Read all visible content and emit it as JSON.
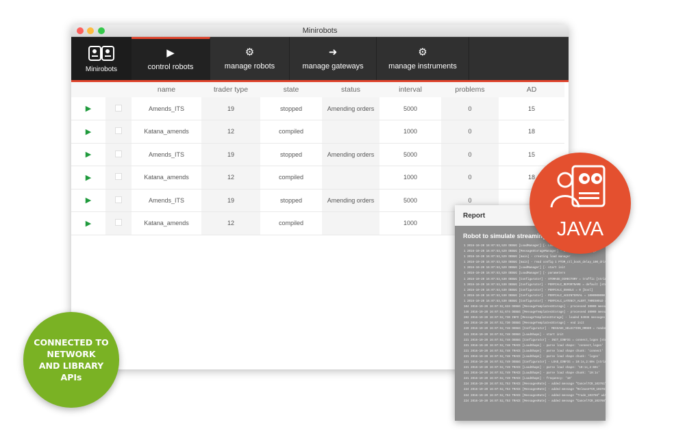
{
  "window": {
    "title": "Minirobots"
  },
  "nav": {
    "brand": "Minirobots",
    "items": [
      {
        "label": "control robots",
        "icon": "play-icon",
        "active": true
      },
      {
        "label": "manage robots",
        "icon": "gear-icon"
      },
      {
        "label": "manage gateways",
        "icon": "arrow-circle-icon"
      },
      {
        "label": "manage instruments",
        "icon": "gears-icon"
      }
    ]
  },
  "table": {
    "columns": [
      "",
      "",
      "name",
      "trader type",
      "state",
      "status",
      "interval",
      "problems",
      "AD"
    ],
    "rows": [
      {
        "name": "Amends_ITS",
        "trader_type": "19",
        "state": "stopped",
        "status": "Amending orders",
        "interval": "5000",
        "problems": "0",
        "ad": "15"
      },
      {
        "name": "Katana_amends",
        "trader_type": "12",
        "state": "compiled",
        "status": "",
        "interval": "1000",
        "problems": "0",
        "ad": "18"
      },
      {
        "name": "Amends_ITS",
        "trader_type": "19",
        "state": "stopped",
        "status": "Amending orders",
        "interval": "5000",
        "problems": "0",
        "ad": "15"
      },
      {
        "name": "Katana_amends",
        "trader_type": "12",
        "state": "compiled",
        "status": "",
        "interval": "1000",
        "problems": "0",
        "ad": "18"
      },
      {
        "name": "Amends_ITS",
        "trader_type": "19",
        "state": "stopped",
        "status": "Amending orders",
        "interval": "5000",
        "problems": "0",
        "ad": ""
      },
      {
        "name": "Katana_amends",
        "trader_type": "12",
        "state": "compiled",
        "status": "",
        "interval": "1000",
        "problems": "",
        "ad": ""
      }
    ]
  },
  "report": {
    "title": "Report",
    "subtitle": "Robot to simulate streaming ...",
    "lines": [
      "1 2016-10-20 16:07:53,529 DEBUG  [LoadManager]        [-  LoadManager",
      "1 2016-10-20 16:07:53,529 DEBUG  [MessageStorageManager] - constructed Message",
      "1 2016-10-20 16:07:53,529 DEBUG  [main]               - creating load manager",
      "1 2016-10-20 16:07:53,529 DEBUG  [main]               - read config 1 PTOM_ctl_book_delay_100_drive.cfg",
      "1 2016-10-20 16:07:53,529 DEBUG  [LoadManager]        [-  start init",
      "1 2016-10-20 16:07:53,529 DEBUG  [LoadManager]        [-  parameters",
      "1 2016-10-20 16:07:53,530 DEBUG  [Configurator]       - STORAGE_DIRECTORY = traffic [string]",
      "1 2016-10-20 16:07:53,530 DEBUG  [Configurator]       - PERFCALC_REPORTNAME = default [string]",
      "1 2016-10-20 16:07:53,530 DEBUG  [Configurator]       - PERFCALC_ENABLE = 0 [bool]",
      "1 2016-10-20 16:07:53,530 DEBUG  [Configurator]       - PERFCALC_AGGINTERVAL = 1000000000 [long]",
      "1 2016-10-20 16:07:53,530 DEBUG  [Configurator]       - PERFCALC_LATENCY_ALERT_THRESHOLD = 50",
      "104 2016-10-20 16:07:52,633 DEBUG [MessageTemplatesStorage] - processed 30000 messages",
      "146 2016-10-20 16:07:52,674 DEBUG [MessageTemplatesStorage] - processed 40000 messages",
      "202 2016-10-20 16:07:52,730 INFO  [MessageTemplatesStorage] - loaded 64036 messages",
      "203 2016-10-20 16:07:52,730 DEBUG [MessageTemplatesStorage] - end init",
      "220 2016-10-20 16:07:52,748 DEBUG [Configurator]      - MESSAGE_SELECTION_ORDER = random [string]",
      "221 2016-10-20 16:07:52,748 DEBUG [LoadShape]         - start init",
      "221 2016-10-20 16:07:52,748 DEBUG [Configurator]      - INIT_CONFIG = connect,logon [string]",
      "221 2016-10-20 16:07:52,748 TRACE [LoadShape]         - parse load shape: 'connect,logon'",
      "221 2016-10-20 16:07:52,748 TRACE [LoadShape]         - parse load shape chunk: 'connect'",
      "221 2016-10-20 16:07:52,748 TRACE [LoadShape]         - parse load shape chunk: 'logon'",
      "221 2016-10-20 16:07:52,749 DEBUG [Configurator]      - LOAD_CONFIG = 10:1s,2:60s [string]",
      "221 2016-10-20 16:07:52,749 TRACE [LoadShape]         - parse load shape: '10:1s,2:60s'",
      "221 2016-10-20 16:07:52,749 TRACE [LoadShape]         - parse load shape chunk: '10:1s'",
      "221 2016-10-20 16:07:52,749 TRACE [LoadShape]         - frequency: '10'",
      "224 2016-10-20 16:07:52,753 TRACE [MessagesRate]      - added message \"CancelTCR_103761\" with rate",
      "224 2016-10-20 16:07:52,753 TRACE [MessagesRate]      - added message \"ReleaseTCR_103761\" with rate",
      "224 2016-10-20 16:07:52,753 TRACE [MessagesRate]      - added message \"Trade_103766\" with rate 30",
      "224 2016-10-20 16:07:52,753 TRACE [MessagesRate]      - added message \"CancelTCR_103766\" with rate"
    ]
  },
  "java_badge": {
    "label": "JAVA"
  },
  "green_badge": {
    "lines": [
      "CONNECTED TO",
      "NETWORK",
      "AND LIBRARY",
      "APIs"
    ]
  },
  "colors": {
    "accent": "#e0442c",
    "nav_bg": "#303030",
    "play": "#1f9a3c",
    "java": "#e4502f",
    "green": "#7ab224"
  }
}
